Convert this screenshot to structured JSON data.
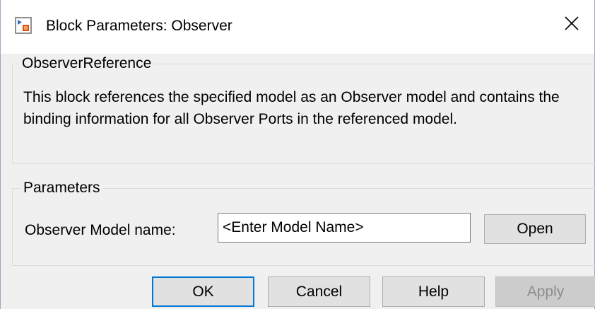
{
  "window": {
    "title": "Block Parameters: Observer"
  },
  "icons": {
    "app": "simulink-block-icon",
    "close": "close-icon"
  },
  "description_group": {
    "title": "ObserverReference",
    "text": "This block references the specified model as an Observer model and contains the binding information for all Observer Ports in the referenced model."
  },
  "parameters_group": {
    "title": "Parameters",
    "model_name_label": "Observer Model name:",
    "model_name_placeholder": "<Enter Model Name>",
    "model_name_value": "",
    "open_label": "Open"
  },
  "buttons": {
    "ok": "OK",
    "cancel": "Cancel",
    "help": "Help",
    "apply": "Apply"
  },
  "colors": {
    "background": "#f0f0f0",
    "titlebar": "#ffffff",
    "default_button_border": "#0078d7",
    "button_face": "#e1e1e1",
    "disabled_text": "#8d8d8d"
  }
}
